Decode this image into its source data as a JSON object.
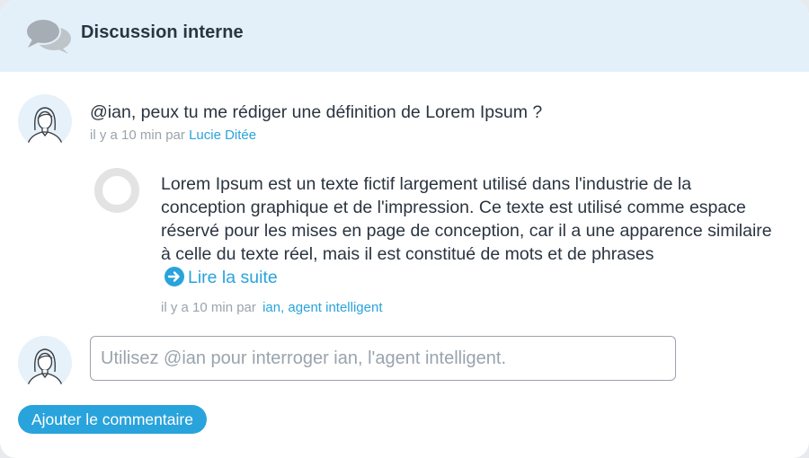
{
  "header": {
    "icon": "chat-bubbles-icon",
    "title": "Discussion interne"
  },
  "message": {
    "avatar_icon": "user-avatar-icon",
    "text": "@ian, peux tu me rédiger une définition de Lorem Ipsum ?",
    "meta_prefix": "il y a 10 min par",
    "author": "Lucie Ditée"
  },
  "reply": {
    "avatar_icon": "agent-ring-icon",
    "text": "Lorem Ipsum est un texte fictif largement utilisé dans l'industrie de la conception graphique et de l'impression. Ce texte est utilisé comme espace réservé pour les mises en page de conception, car il a une apparence similaire à celle du texte réel, mais il est constitué de mots et de phrases",
    "read_more_icon": "arrow-right-circle-icon",
    "read_more": "Lire la suite",
    "meta_prefix": "il y a 10 min par",
    "author": "ian, agent intelligent"
  },
  "composer": {
    "avatar_icon": "user-avatar-icon",
    "placeholder": "Utilisez @ian pour interroger ian, l'agent intelligent.",
    "value": ""
  },
  "submit_button": {
    "label": "Ajouter le commentaire"
  },
  "colors": {
    "header_bg": "#e3f0f9",
    "accent": "#29a3dc",
    "text": "#2b3440",
    "muted": "#9aa3ad"
  }
}
